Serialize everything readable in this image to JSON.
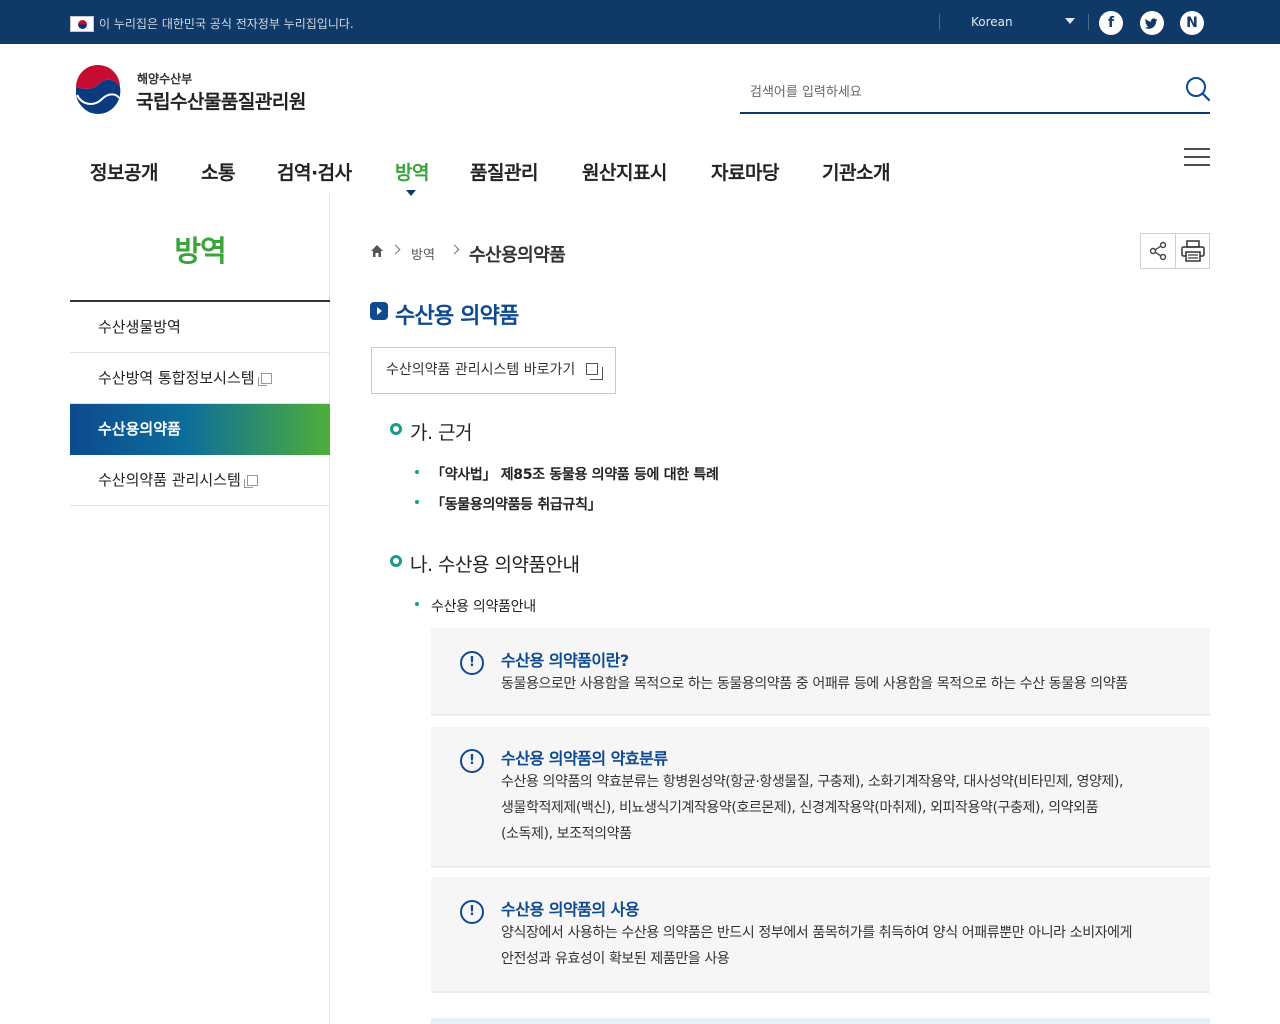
{
  "gov_bar": {
    "notice": "이 누리집은 대한민국 공식 전자정부 누리집입니다.",
    "language": "Korean",
    "social": [
      {
        "name": "facebook",
        "glyph": "f"
      },
      {
        "name": "twitter",
        "glyph": "t"
      },
      {
        "name": "naver",
        "glyph": "N"
      }
    ]
  },
  "header": {
    "logo_sub": "해양수산부",
    "logo_main": "국립수산물품질관리원",
    "search_placeholder": "검색어를 입력하세요"
  },
  "gnb": {
    "items": [
      "정보공개",
      "소통",
      "검역·검사",
      "방역",
      "품질관리",
      "원산지표시",
      "자료마당",
      "기관소개"
    ],
    "active": "방역"
  },
  "lnb": {
    "title": "방역",
    "items": [
      {
        "label": "수산생물방역",
        "external": false
      },
      {
        "label": "수산방역 통합정보시스템",
        "external": true
      },
      {
        "label": "수산용의약품",
        "external": false,
        "active": true
      },
      {
        "label": "수산의약품 관리시스템",
        "external": true
      }
    ]
  },
  "breadcrumb": {
    "level1": "방역",
    "current": "수산용의약품"
  },
  "content": {
    "title": "수산용 의약품",
    "link_button": "수산의약품 관리시스템 바로가기",
    "section1": {
      "heading": "가. 근거",
      "items": [
        "「약사법」 제85조 동물용 의약품 등에 대한 특례",
        "「동물용의약품등 취급규칙」"
      ]
    },
    "section2": {
      "heading": "나. 수산용 의약품안내",
      "items": [
        "수산용 의약품안내"
      ],
      "boxes": [
        {
          "title": "수산용 의약품이란?",
          "lines": [
            "동물용으로만 사용함을 목적으로 하는 동물용의약품 중 어패류 등에 사용함을 목적으로 하는 수산 동물용 의약품"
          ]
        },
        {
          "title": "수산용 의약품의 약효분류",
          "lines": [
            "수산용 의약품의 약효분류는 항병원성약(항균·항생물질, 구충제), 소화기계작용약, 대사성약(비타민제, 영양제),",
            "생물학적제제(백신), 비뇨생식기계작용약(호르몬제), 신경계작용약(마취제), 외피작용약(구충제), 의약외품",
            "(소독제), 보조적의약품"
          ]
        },
        {
          "title": "수산용 의약품의 사용",
          "lines": [
            "양식장에서 사용하는 수산용 의약품은 반드시 정부에서 품목허가를 취득하여 양식 어패류뿐만 아니라 소비자에게",
            "안전성과 유효성이 확보된 제품만을 사용"
          ]
        }
      ]
    }
  },
  "colors": {
    "gov_bar": "#0f3a67",
    "primary": "#0d4a8f",
    "accent_green": "#3aa33a",
    "teal": "#1a9a8a"
  }
}
